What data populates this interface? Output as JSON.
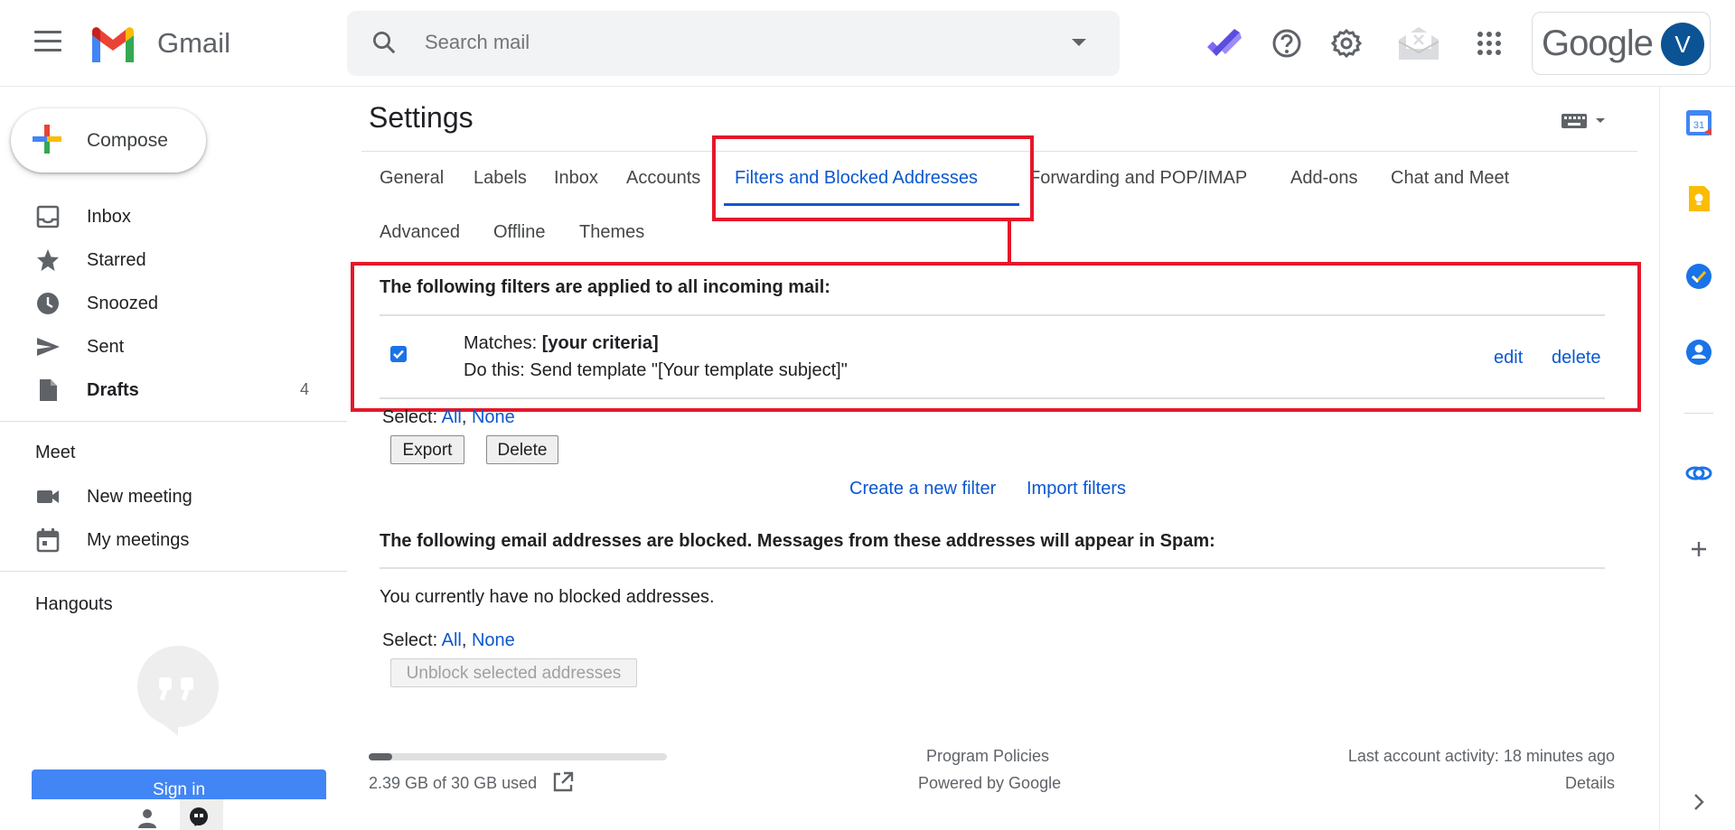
{
  "app": {
    "name": "Gmail"
  },
  "search": {
    "placeholder": "Search mail"
  },
  "account": {
    "brand": "Google",
    "avatar_letter": "V"
  },
  "sidebar": {
    "compose_label": "Compose",
    "items": [
      {
        "label": "Inbox",
        "icon": "inbox-icon"
      },
      {
        "label": "Starred",
        "icon": "star-icon"
      },
      {
        "label": "Snoozed",
        "icon": "clock-icon"
      },
      {
        "label": "Sent",
        "icon": "send-icon"
      },
      {
        "label": "Drafts",
        "icon": "draft-icon",
        "count": "4"
      }
    ],
    "meet": {
      "heading": "Meet",
      "items": [
        {
          "label": "New meeting",
          "icon": "video-camera-icon"
        },
        {
          "label": "My meetings",
          "icon": "calendar-icon"
        }
      ]
    },
    "hangouts": {
      "heading": "Hangouts",
      "signin_label": "Sign in"
    }
  },
  "settings": {
    "title": "Settings",
    "tabs": [
      {
        "label": "General"
      },
      {
        "label": "Labels"
      },
      {
        "label": "Inbox"
      },
      {
        "label": "Accounts"
      },
      {
        "label": "Filters and Blocked Addresses",
        "active": true
      },
      {
        "label": "Forwarding and POP/IMAP"
      },
      {
        "label": "Add-ons"
      },
      {
        "label": "Chat and Meet"
      },
      {
        "label": "Advanced"
      },
      {
        "label": "Offline"
      },
      {
        "label": "Themes"
      }
    ],
    "filters": {
      "heading": "The following filters are applied to all incoming mail:",
      "filter": {
        "matches_prefix": "Matches: ",
        "matches_value": "[your criteria]",
        "action": "Do this: Send template \"[Your template subject]\"",
        "checked": true,
        "edit_label": "edit",
        "delete_label": "delete"
      },
      "select_prefix": "Select: ",
      "select_all": "All",
      "select_sep": ",",
      "select_none": "None",
      "export_label": "Export",
      "delete_label": "Delete",
      "create_filter": "Create a new filter",
      "import_filters": "Import filters"
    },
    "blocked": {
      "heading": "The following email addresses are blocked. Messages from these addresses will appear in Spam:",
      "empty_message": "You currently have no blocked addresses.",
      "select_prefix": "Select: ",
      "select_all": "All",
      "select_sep": ",",
      "select_none": "None",
      "unblock_label": "Unblock selected addresses"
    }
  },
  "footer": {
    "storage_used": "2.39 GB of 30 GB used",
    "storage_fraction": 0.08,
    "program_policies": "Program Policies",
    "powered_by": "Powered by Google",
    "last_activity": "Last account activity: 18 minutes ago",
    "details": "Details"
  },
  "colors": {
    "accent": "#0b57d0",
    "highlight": "#e5172b",
    "avatar": "#0b5394"
  }
}
